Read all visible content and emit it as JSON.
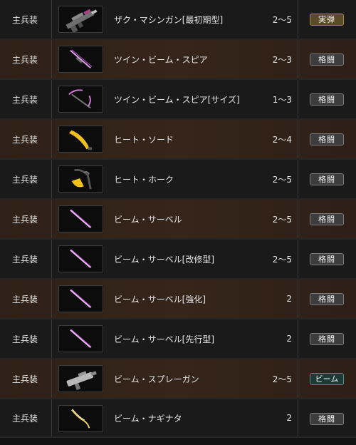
{
  "rows": [
    {
      "slot": "主兵装",
      "name": "ザク・マシンガン[最初期型]",
      "range": "2〜5",
      "type": "実弾",
      "type_kind": "live",
      "icon": "machine-gun-icon"
    },
    {
      "slot": "主兵装",
      "name": "ツイン・ビーム・スピア",
      "range": "2〜3",
      "type": "格闘",
      "type_kind": "melee",
      "icon": "twin-beam-spear-icon"
    },
    {
      "slot": "主兵装",
      "name": "ツイン・ビーム・スピア[サイズ]",
      "range": "1〜3",
      "type": "格闘",
      "type_kind": "melee",
      "icon": "twin-beam-spear-scythe-icon"
    },
    {
      "slot": "主兵装",
      "name": "ヒート・ソード",
      "range": "2〜4",
      "type": "格闘",
      "type_kind": "melee",
      "icon": "heat-sword-icon"
    },
    {
      "slot": "主兵装",
      "name": "ヒート・ホーク",
      "range": "2〜5",
      "type": "格闘",
      "type_kind": "melee",
      "icon": "heat-hawk-icon"
    },
    {
      "slot": "主兵装",
      "name": "ビーム・サーベル",
      "range": "2〜5",
      "type": "格闘",
      "type_kind": "melee",
      "icon": "beam-saber-icon"
    },
    {
      "slot": "主兵装",
      "name": "ビーム・サーベル[改修型]",
      "range": "2〜5",
      "type": "格闘",
      "type_kind": "melee",
      "icon": "beam-saber-icon"
    },
    {
      "slot": "主兵装",
      "name": "ビーム・サーベル[強化]",
      "range": "2",
      "type": "格闘",
      "type_kind": "melee",
      "icon": "beam-saber-icon"
    },
    {
      "slot": "主兵装",
      "name": "ビーム・サーベル[先行型]",
      "range": "2",
      "type": "格闘",
      "type_kind": "melee",
      "icon": "beam-saber-icon"
    },
    {
      "slot": "主兵装",
      "name": "ビーム・スプレーガン",
      "range": "2〜5",
      "type": "ビーム",
      "type_kind": "beam",
      "icon": "beam-spray-gun-icon"
    },
    {
      "slot": "主兵装",
      "name": "ビーム・ナギナタ",
      "range": "2",
      "type": "格闘",
      "type_kind": "melee",
      "icon": "beam-naginata-icon"
    }
  ],
  "colors": {
    "row_dark": "#1a1a1a",
    "row_brown": "#33241a",
    "badge_live": "#5a4a26",
    "badge_melee": "#3d3d3d",
    "badge_beam": "#1d3a36",
    "beam_pink": "#d070e0",
    "heat_yellow": "#f2c21a"
  }
}
